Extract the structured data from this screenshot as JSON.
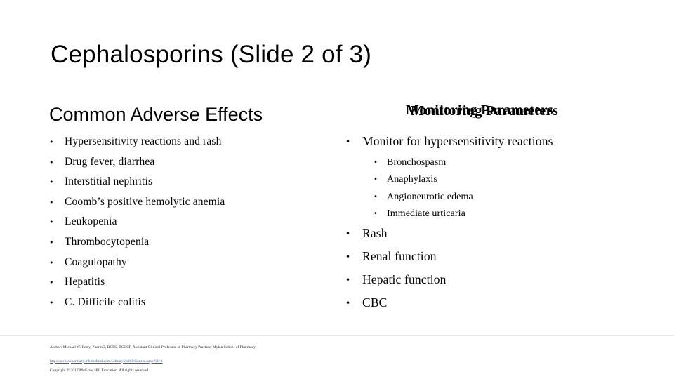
{
  "slide": {
    "title": "Cephalosporins  (Slide 2 of 3)",
    "left_column": {
      "heading": "Common Adverse Effects",
      "bullets": [
        "Hypersensitivity reactions and rash",
        "Drug fever, diarrhea",
        "Interstitial nephritis",
        "Coomb’s positive hemolytic anemia",
        "Leukopenia",
        "Thrombocytopenia",
        "Coagulopathy",
        "Hepatitis",
        "C. Difficile colitis"
      ]
    },
    "right_column": {
      "heading": "Monitoring Parameters",
      "items": [
        {
          "level": 1,
          "text": "Monitor for hypersensitivity reactions"
        },
        {
          "level": 2,
          "text": "Bronchospasm"
        },
        {
          "level": 2,
          "text": "Anaphylaxis"
        },
        {
          "level": 2,
          "text": "Angioneurotic edema"
        },
        {
          "level": 2,
          "text": "Immediate urticaria"
        },
        {
          "level": 1,
          "text": "Rash"
        },
        {
          "level": 1,
          "text": "Renal function"
        },
        {
          "level": 1,
          "text": "Hepatic function"
        },
        {
          "level": 1,
          "text": "CBC"
        }
      ]
    },
    "footer": {
      "author": "Author: Michael W. Perry, PharmD, BCPS, BCCCP, Assistant Clinical Professor of Pharmacy Practice, Mylan School of Pharmacy",
      "link": "http://accesspharmacy.mhmedical.com/LibraryVisibleCourse.aspx?id=2",
      "copyright": "Copyright © 2017 McGraw Hill Education. All rights reserved."
    },
    "bullet_glyph": "•",
    "colors": {
      "text": "#000000",
      "link": "#2b5faa",
      "background": "#ffffff"
    }
  }
}
